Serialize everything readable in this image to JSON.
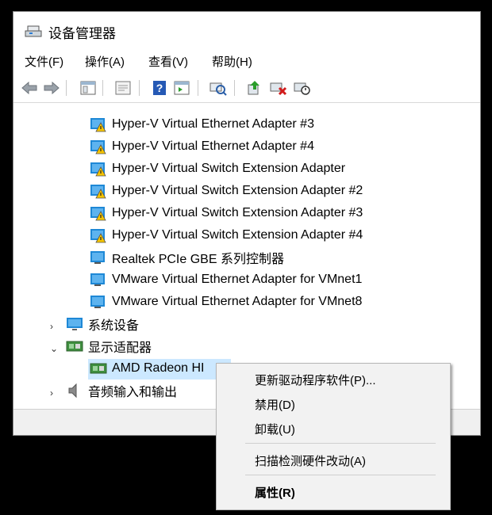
{
  "window": {
    "title": "设备管理器"
  },
  "menubar": [
    {
      "label": "文件(F)"
    },
    {
      "label": "操作(A)"
    },
    {
      "label": "查看(V)"
    },
    {
      "label": "帮助(H)"
    }
  ],
  "toolbar": {
    "buttons": [
      "back-icon",
      "forward-icon",
      "show-hide-tree-icon",
      "properties-icon",
      "help-icon",
      "update-driver-icon",
      "scan-hardware-icon",
      "enable-device-icon",
      "uninstall-device-icon",
      "disable-device-icon"
    ]
  },
  "tree": {
    "network_adapters": [
      {
        "label": "Hyper-V Virtual Ethernet Adapter #3",
        "warning": true
      },
      {
        "label": "Hyper-V Virtual Ethernet Adapter #4",
        "warning": true
      },
      {
        "label": "Hyper-V Virtual Switch Extension Adapter",
        "warning": true
      },
      {
        "label": "Hyper-V Virtual Switch Extension Adapter #2",
        "warning": true
      },
      {
        "label": "Hyper-V Virtual Switch Extension Adapter #3",
        "warning": true
      },
      {
        "label": "Hyper-V Virtual Switch Extension Adapter #4",
        "warning": true
      },
      {
        "label": "Realtek PCIe GBE 系列控制器",
        "warning": false
      },
      {
        "label": "VMware Virtual Ethernet Adapter for VMnet1",
        "warning": false
      },
      {
        "label": "VMware Virtual Ethernet Adapter for VMnet8",
        "warning": false
      }
    ],
    "system_devices": "系统设备",
    "display_adapters": "显示适配器",
    "amd_radeon": "AMD Radeon HI",
    "audio": "音频输入和输出"
  },
  "context_menu": {
    "update_driver": "更新驱动程序软件(P)...",
    "disable": "禁用(D)",
    "uninstall": "卸载(U)",
    "scan": "扫描检测硬件改动(A)",
    "properties": "属性(R)"
  },
  "colors": {
    "selection": "#cce8ff",
    "warning": "#f5c400",
    "monitor": "#1e88d6"
  }
}
